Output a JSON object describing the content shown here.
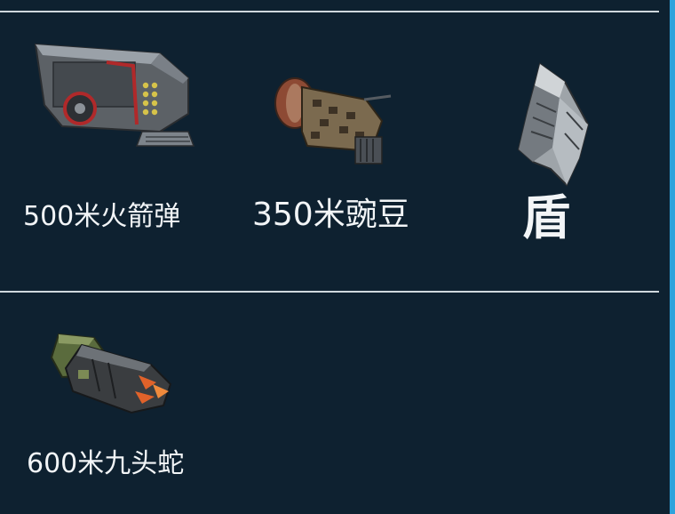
{
  "items": [
    {
      "id": "rocket",
      "label": "500米火箭弹",
      "icon": "rocket-launcher-icon"
    },
    {
      "id": "pea",
      "label": "350米豌豆",
      "icon": "pea-cannon-icon"
    },
    {
      "id": "shield",
      "label": "盾",
      "icon": "shield-icon"
    },
    {
      "id": "hydra",
      "label": "600米九头蛇",
      "icon": "hydra-launcher-icon"
    }
  ],
  "colors": {
    "background": "#0e2130",
    "divider": "#cfd8dd",
    "text": "#f2f5f7",
    "edge_accent": "#2ea3dc"
  }
}
